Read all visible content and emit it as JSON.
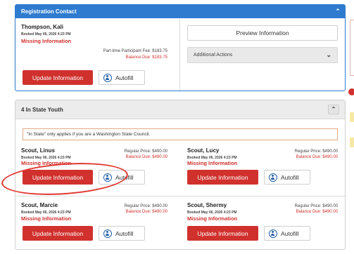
{
  "registration_contact": {
    "header": "Registration Contact",
    "name": "Thompson, Kali",
    "booked": "Booked May 06, 2026 4:23 PM",
    "missing": "Missing Information",
    "fee_line": "Part-time Participant Fee: $183.75",
    "balance_line": "Balance Due: $183.75",
    "update_label": "Update Information",
    "autofill_label": "Autofill",
    "preview_label": "Preview Information",
    "actions_label": "Additional Actions"
  },
  "youth_section": {
    "header": "4 In State Youth",
    "notice": "\"In State\" only applies if you are a Washington State Council.",
    "participants": [
      {
        "name": "Scout, Linus",
        "booked": "Booked May 06, 2026 4:23 PM",
        "missing": "Missing Information",
        "price": "Regular Price: $490.00",
        "due": "Balance Due: $490.00",
        "update_label": "Update Information",
        "autofill_label": "Autofill"
      },
      {
        "name": "Scout, Lucy",
        "booked": "Booked May 06, 2026 4:23 PM",
        "missing": "Missing Information",
        "price": "Regular Price: $490.00",
        "due": "Balance Due: $490.00",
        "update_label": "Update Information",
        "autofill_label": "Autofill"
      },
      {
        "name": "Scout, Marcie",
        "booked": "Booked May 06, 2026 4:23 PM",
        "missing": "Missing Information",
        "price": "Regular Price: $490.00",
        "due": "Balance Due: $490.00",
        "update_label": "Update Information",
        "autofill_label": "Autofill"
      },
      {
        "name": "Scout, Shermy",
        "booked": "Booked May 06, 2026 4:23 PM",
        "missing": "Missing Information",
        "price": "Regular Price: $490.00",
        "due": "Balance Due: $490.00",
        "update_label": "Update Information",
        "autofill_label": "Autofill"
      }
    ]
  },
  "colors": {
    "header_blue": "#2e7bcf",
    "danger_red": "#d0312d",
    "notice_border": "#e3a77d"
  },
  "icons": {
    "collapse": "chevron-up-icon",
    "dropdown": "chevron-down-icon",
    "autofill": "person-circle-icon"
  }
}
